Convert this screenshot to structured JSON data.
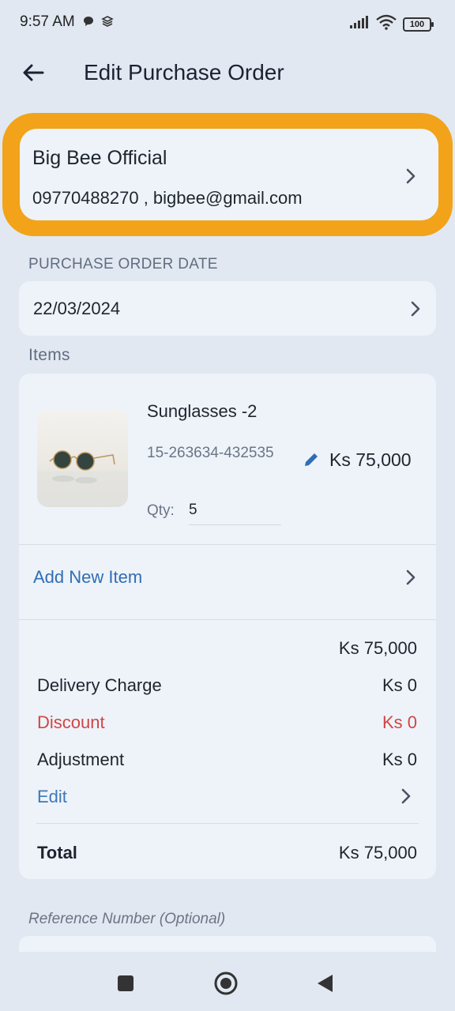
{
  "status_bar": {
    "time": "9:57 AM",
    "battery": "100",
    "icons": [
      "chat-bubble-icon",
      "layers-icon",
      "signal-icon",
      "wifi-icon",
      "battery-icon"
    ]
  },
  "header": {
    "title": "Edit Purchase Order",
    "back_icon": "arrow-left-icon"
  },
  "vendor": {
    "name": "Big Bee Official",
    "contact": "09770488270 , bigbee@gmail.com",
    "highlight_color": "#f2a31a"
  },
  "order_date": {
    "label": "PURCHASE ORDER DATE",
    "value": "22/03/2024"
  },
  "items": {
    "label": "Items",
    "list": [
      {
        "name": "Sunglasses -2",
        "sku": "15-263634-432535",
        "qty_label": "Qty:",
        "qty": "5",
        "price": "Ks 75,000"
      }
    ],
    "add_label": "Add New Item"
  },
  "summary": {
    "subtotal": "Ks 75,000",
    "delivery_label": "Delivery Charge",
    "delivery_value": "Ks 0",
    "discount_label": "Discount",
    "discount_value": "Ks 0",
    "adjustment_label": "Adjustment",
    "adjustment_value": "Ks 0",
    "edit_label": "Edit",
    "total_label": "Total",
    "total_value": "Ks 75,000"
  },
  "reference": {
    "label": "Reference Number (Optional)"
  },
  "colors": {
    "background": "#e1e8f1",
    "card": "#eef3f9",
    "link": "#2f6db5",
    "discount": "#d04545"
  }
}
